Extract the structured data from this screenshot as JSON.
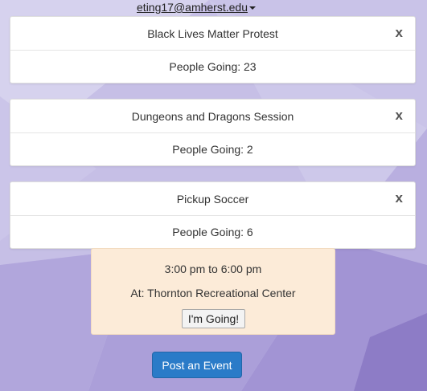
{
  "account": {
    "email": "eting17@amherst.edu"
  },
  "events": [
    {
      "title": "Black Lives Matter Protest",
      "going": "People Going: 23",
      "close": "x"
    },
    {
      "title": "Dungeons and Dragons Session",
      "going": "People Going: 2",
      "close": "x"
    },
    {
      "title": "Pickup Soccer",
      "going": "People Going: 6",
      "close": "x"
    }
  ],
  "detail": {
    "time": "3:00 pm to 6:00 pm",
    "location": "At: Thornton Recreational Center",
    "going_button": "I'm Going!"
  },
  "post_button": "Post an Event",
  "colors": {
    "primary": "#2a7bc8",
    "detail_bg": "#fcebd8",
    "background": "#c9c3e6"
  }
}
